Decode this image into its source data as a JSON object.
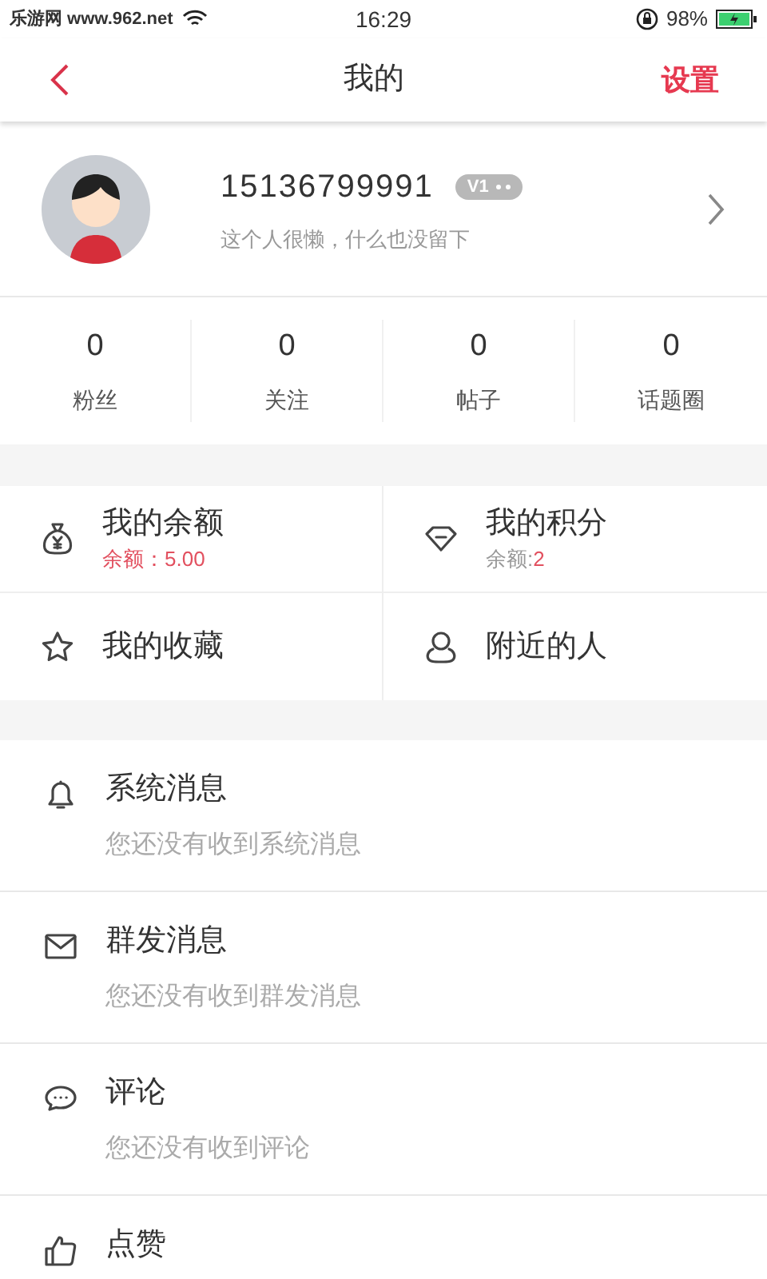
{
  "status_bar": {
    "carrier": "乐游网 www.962.net",
    "time": "16:29",
    "battery": "98%"
  },
  "header": {
    "title": "我的",
    "action": "设置"
  },
  "profile": {
    "name": "15136799991",
    "level_badge": "V1",
    "bio": "这个人很懒，什么也没留下"
  },
  "stats": [
    {
      "value": "0",
      "label": "粉丝"
    },
    {
      "value": "0",
      "label": "关注"
    },
    {
      "value": "0",
      "label": "帖子"
    },
    {
      "value": "0",
      "label": "话题圈"
    }
  ],
  "grid": [
    {
      "kind": "balance",
      "label": "我的余额",
      "sub_label": "余额：",
      "sub_value": "5.00",
      "sub_label_accent": true
    },
    {
      "kind": "points",
      "label": "我的积分",
      "sub_label": "余额: ",
      "sub_value": "2",
      "sub_label_accent": false
    },
    {
      "kind": "favorites",
      "label": "我的收藏"
    },
    {
      "kind": "nearby",
      "label": "附近的人"
    }
  ],
  "messages": [
    {
      "kind": "system",
      "title": "系统消息",
      "subtitle": "您还没有收到系统消息"
    },
    {
      "kind": "group",
      "title": "群发消息",
      "subtitle": "您还没有收到群发消息"
    },
    {
      "kind": "comment",
      "title": "评论",
      "subtitle": "您还没有收到评论"
    },
    {
      "kind": "like",
      "title": "点赞"
    }
  ]
}
